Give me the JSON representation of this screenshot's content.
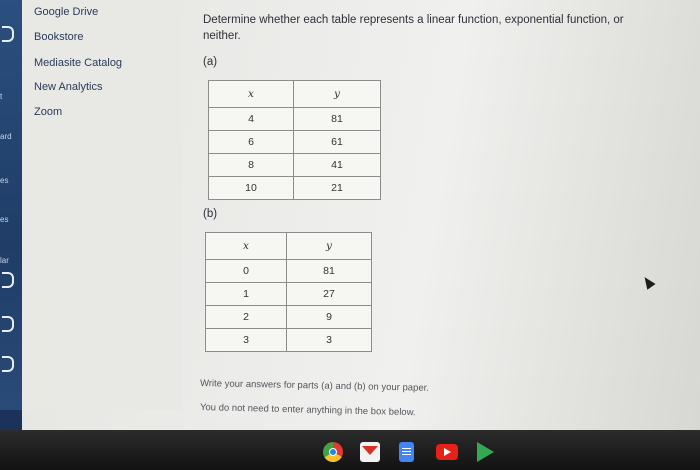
{
  "sidebar": {
    "fragments": [
      "t",
      "ard",
      "es",
      "es",
      "lar"
    ],
    "items": [
      "Google Drive",
      "Bookstore",
      "Mediasite Catalog",
      "New Analytics",
      "Zoom"
    ]
  },
  "question": {
    "line1": "Determine whether each table represents a linear function, exponential function, or",
    "line2": "neither.",
    "part_a_label": "(a)",
    "part_b_label": "(b)",
    "table_a": {
      "headers": [
        "x",
        "y"
      ],
      "rows": [
        [
          "4",
          "81"
        ],
        [
          "6",
          "61"
        ],
        [
          "8",
          "41"
        ],
        [
          "10",
          "21"
        ]
      ]
    },
    "table_b": {
      "headers": [
        "x",
        "y"
      ],
      "rows": [
        [
          "0",
          "81"
        ],
        [
          "1",
          "27"
        ],
        [
          "2",
          "9"
        ],
        [
          "3",
          "3"
        ]
      ]
    },
    "note1": "Write your answers for parts (a) and (b) on your paper.",
    "note2": "You do not need to enter anything in the box below."
  },
  "taskbar": {
    "icons": [
      "chrome-icon",
      "gmail-icon",
      "docs-icon",
      "youtube-icon",
      "play-store-icon"
    ]
  },
  "colors": {
    "nav": "#2b4f80",
    "taskbar": "#121212",
    "text": "#2f3038"
  }
}
